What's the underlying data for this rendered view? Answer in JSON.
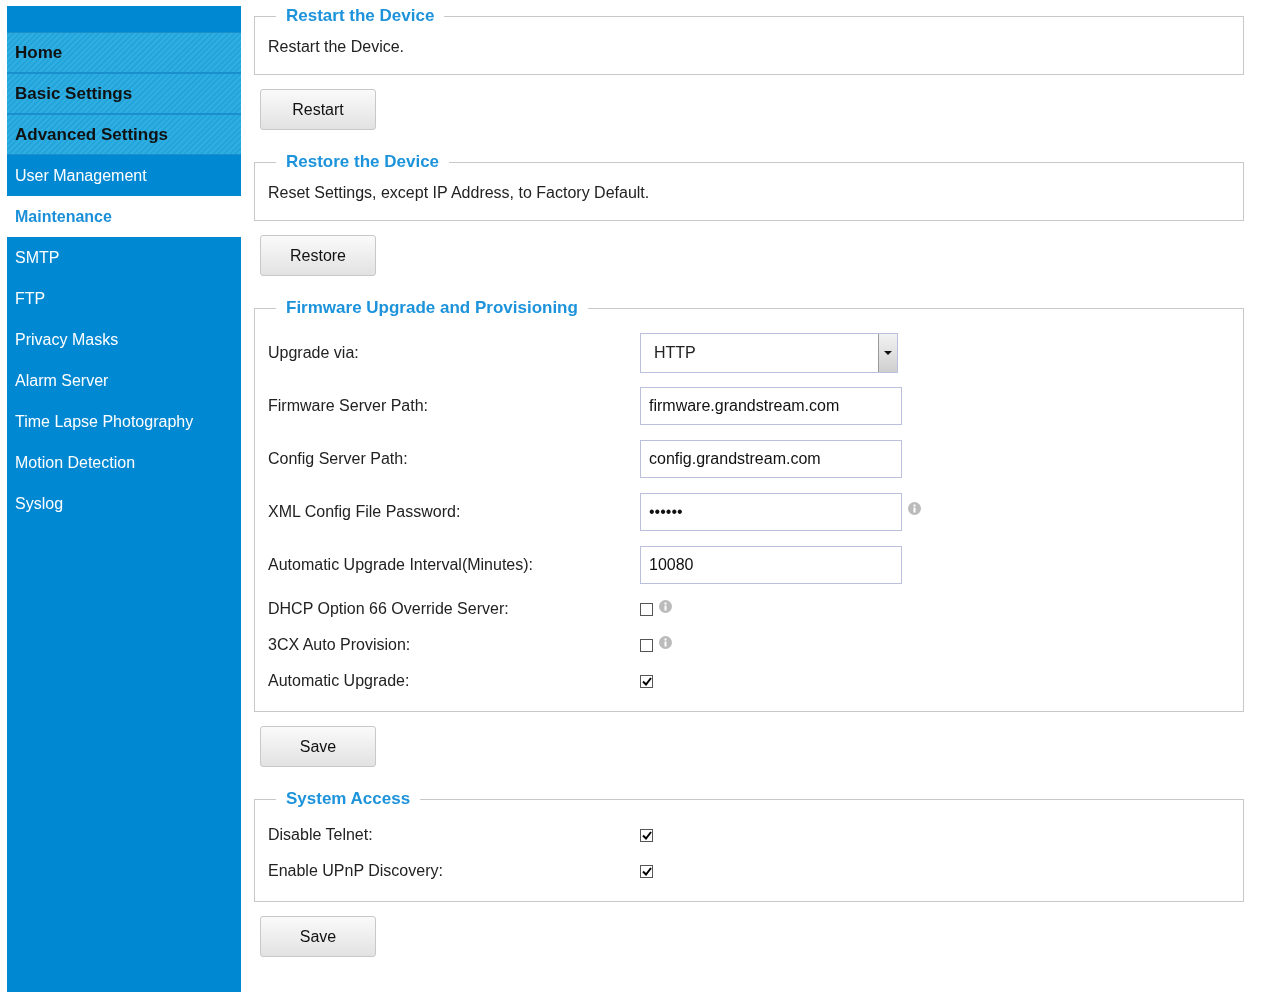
{
  "sidebar": {
    "items": [
      {
        "label": "Home",
        "kind": "section",
        "selected": false
      },
      {
        "label": "Basic Settings",
        "kind": "section",
        "selected": false
      },
      {
        "label": "Advanced Settings",
        "kind": "section",
        "selected": false
      },
      {
        "label": "User Management",
        "kind": "sub",
        "selected": false
      },
      {
        "label": "Maintenance",
        "kind": "sub",
        "selected": true
      },
      {
        "label": "SMTP",
        "kind": "sub",
        "selected": false
      },
      {
        "label": "FTP",
        "kind": "sub",
        "selected": false
      },
      {
        "label": "Privacy Masks",
        "kind": "sub",
        "selected": false
      },
      {
        "label": "Alarm Server",
        "kind": "sub",
        "selected": false
      },
      {
        "label": "Time Lapse Photography",
        "kind": "sub",
        "selected": false
      },
      {
        "label": "Motion Detection",
        "kind": "sub",
        "selected": false
      },
      {
        "label": "Syslog",
        "kind": "sub",
        "selected": false
      }
    ]
  },
  "sections": [
    {
      "title": "Restart the Device",
      "text": "Restart the Device.",
      "button": "Restart"
    },
    {
      "title": "Restore the Device",
      "text": "Reset Settings, except IP Address, to Factory Default.",
      "button": "Restore"
    },
    {
      "title": "Firmware Upgrade and Provisioning",
      "button": "Save",
      "fields": [
        {
          "label": "Upgrade via:",
          "kind": "select",
          "value": "HTTP",
          "info": false
        },
        {
          "label": "Firmware Server Path:",
          "kind": "text",
          "value": "firmware.grandstream.com",
          "info": false
        },
        {
          "label": "Config Server Path:",
          "kind": "text",
          "value": "config.grandstream.com",
          "info": false
        },
        {
          "label": "XML Config File Password:",
          "kind": "password",
          "value": "••••••",
          "info": true
        },
        {
          "label": "Automatic Upgrade Interval(Minutes):",
          "kind": "text",
          "value": "10080",
          "info": false
        },
        {
          "label": "DHCP Option 66 Override Server:",
          "kind": "checkbox",
          "checked": false,
          "info": true
        },
        {
          "label": "3CX Auto Provision:",
          "kind": "checkbox",
          "checked": false,
          "info": true
        },
        {
          "label": "Automatic Upgrade:",
          "kind": "checkbox",
          "checked": true,
          "info": false
        }
      ]
    },
    {
      "title": "System Access",
      "button": "Save",
      "fields": [
        {
          "label": "Disable Telnet:",
          "kind": "checkbox",
          "checked": true,
          "info": false
        },
        {
          "label": "Enable UPnP Discovery:",
          "kind": "checkbox",
          "checked": true,
          "info": false
        }
      ]
    }
  ]
}
